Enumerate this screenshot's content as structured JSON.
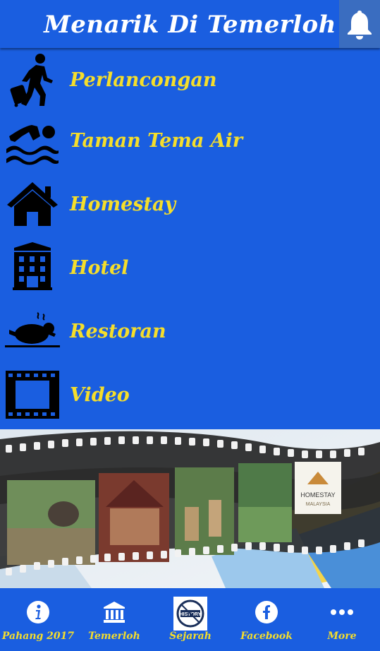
{
  "header": {
    "title": "Menarik Di Temerloh",
    "bell_icon": "bell-icon"
  },
  "menu": {
    "items": [
      {
        "label": "Perlancongan",
        "icon": "traveler-icon"
      },
      {
        "label": "Taman Tema Air",
        "icon": "swimmer-icon"
      },
      {
        "label": "Homestay",
        "icon": "house-icon"
      },
      {
        "label": "Hotel",
        "icon": "hotel-building-icon"
      },
      {
        "label": "Restoran",
        "icon": "roast-chicken-icon"
      },
      {
        "label": "Video",
        "icon": "film-strip-icon"
      }
    ]
  },
  "banner": {
    "logo_text": "HOMESTAY",
    "logo_subtext": "MALAYSIA"
  },
  "bottom_nav": {
    "items": [
      {
        "label": "Pahang 2017",
        "icon": "info-icon"
      },
      {
        "label": "Temerloh",
        "icon": "museum-icon"
      },
      {
        "label": "Sejarah",
        "icon": "history-icon",
        "icon_text": "HISTORY"
      },
      {
        "label": "Facebook",
        "icon": "facebook-icon"
      },
      {
        "label": "More",
        "icon": "more-icon"
      }
    ]
  },
  "colors": {
    "background": "#1a5ee0",
    "label": "#f5de2b",
    "title": "#ffffff"
  }
}
